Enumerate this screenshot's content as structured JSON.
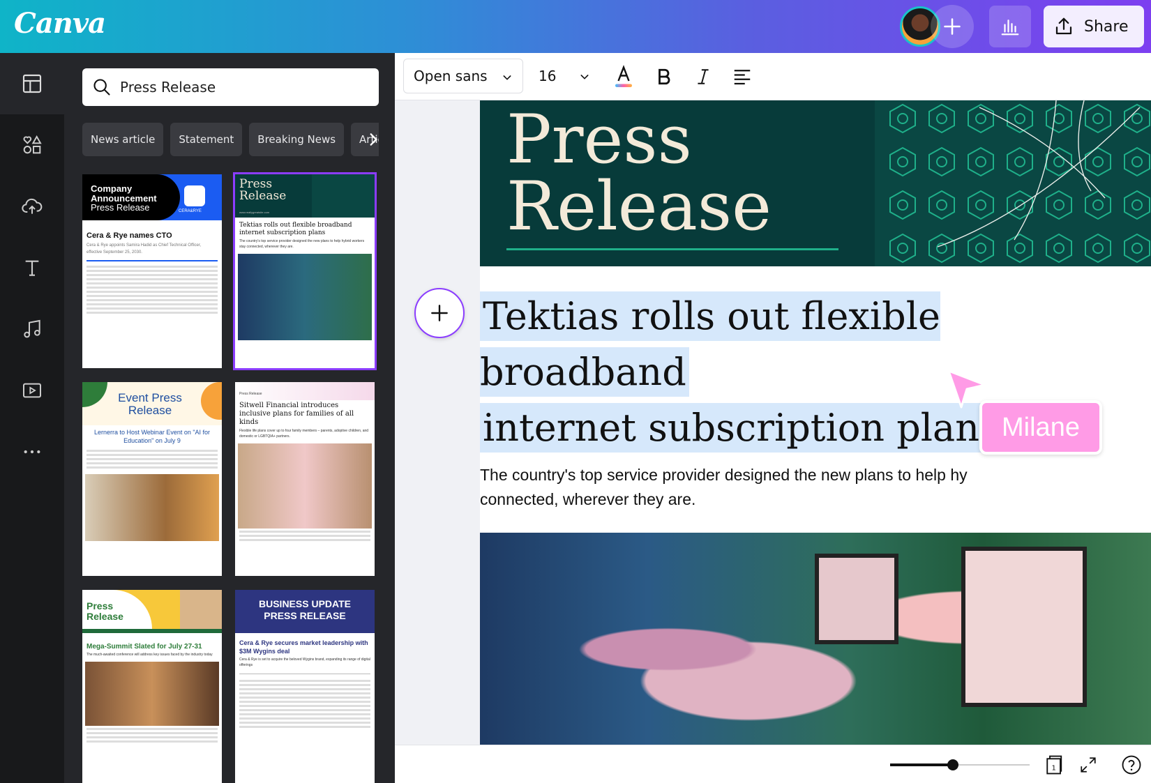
{
  "header": {
    "logo": "Canva",
    "share_label": "Share"
  },
  "rail": {
    "items": [
      "layout-icon",
      "elements-icon",
      "uploads-icon",
      "text-icon",
      "audio-icon",
      "video-icon",
      "more-icon"
    ]
  },
  "panel": {
    "search_value": "Press Release",
    "chips": [
      "News article",
      "Statement",
      "Breaking News",
      "Article"
    ],
    "templates": [
      {
        "title_lines": [
          "Company",
          "Announcement"
        ],
        "subtitle": "Press Release",
        "badge": "CERA&RYE",
        "headline": "Cera & Rye names CTO",
        "intro": "Cera & Rye appoints Samira Hadid as Chief Technical Officer, effective September 25, 2030."
      },
      {
        "title_lines": [
          "Press",
          "Release"
        ],
        "site": "www.reallygreatsite.com",
        "headline": "Tektias rolls out flexible broadband internet subscription plans",
        "intro": "The country's top service provider designed the new plans to help hybrid workers stay connected, wherever they are."
      },
      {
        "title_lines": [
          "Event Press",
          "Release"
        ],
        "headline": "Lernerra to Host Webinar Event on \"AI for Education\" on July 9"
      },
      {
        "kicker": "Press Release",
        "headline": "Sitwell Financial introduces inclusive plans for families of all kinds",
        "intro": "Flexible life plans cover up to four family members – parents, adoptive children, and domestic or LGBTQIA+ partners."
      },
      {
        "title_lines": [
          "Press",
          "Release"
        ],
        "headline": "Mega-Summit Slated for July 27-31",
        "intro": "The much-awaited conference will address key issues faced by the industry today"
      },
      {
        "title_lines": [
          "BUSINESS UPDATE",
          "PRESS RELEASE"
        ],
        "headline": "Cera & Rye secures market leadership with $3M Wygins deal",
        "intro": "Cera & Rye is set to acquire the beloved Wygins brand, expanding its range of digital offerings"
      }
    ]
  },
  "toolbar": {
    "font_family": "Open sans",
    "font_size": "16"
  },
  "document": {
    "banner_title_lines": [
      "Press",
      "Release"
    ],
    "headline_lines": [
      "Tektias rolls out flexible broadband",
      "internet subscription plans"
    ],
    "subtext_lines": [
      "The country's top service provider designed the new plans to help hy",
      "connected, wherever they are."
    ]
  },
  "collaborator": {
    "name": "Milane",
    "color": "#ff9be6"
  },
  "bottombar": {
    "zoom_fraction": 0.45,
    "page_count": "1"
  },
  "colors": {
    "brand_purple": "#8b3dff",
    "banner_teal": "#073b3a",
    "highlight": "#d6e8fb"
  }
}
